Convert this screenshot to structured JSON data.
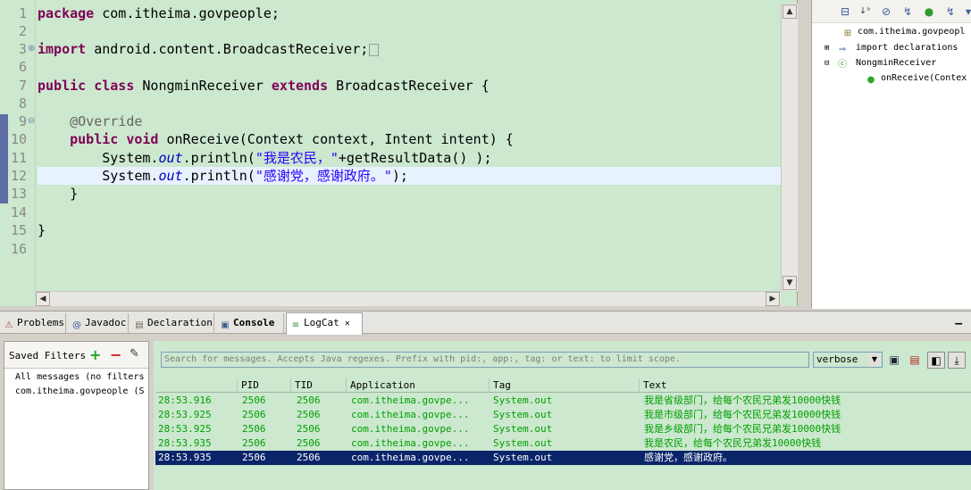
{
  "editor": {
    "line_numbers": [
      "1",
      "2",
      "3",
      "6",
      "7",
      "8",
      "9",
      "10",
      "11",
      "12",
      "13",
      "14",
      "15",
      "16"
    ],
    "lines": {
      "l1_kw": "package",
      "l1_rest": " com.itheima.govpeople;",
      "l3_kw": "import",
      "l3_rest": " android.content.BroadcastReceiver;",
      "l7_kw1": "public",
      "l7_kw2": "class",
      "l7_name": " NongminReceiver ",
      "l7_kw3": "extends",
      "l7_rest": " BroadcastReceiver {",
      "l9_ann": "@Override",
      "l10_kw1": "public",
      "l10_kw2": "void",
      "l10_rest": " onReceive(Context context, Intent intent) {",
      "l11_a": "System.",
      "l11_fld": "out",
      "l11_b": ".println(",
      "l11_str": "\"我是农民，\"",
      "l11_c": "+getResultData() );",
      "l12_a": "System.",
      "l12_fld": "out",
      "l12_b": ".println(",
      "l12_str": "\"感谢党，感谢政府。\"",
      "l12_c": ");",
      "l13": "    }",
      "l15": "}"
    }
  },
  "outline": {
    "items": [
      {
        "label": "com.itheima.govpeopl",
        "icon": "package-icon"
      },
      {
        "label": "import declarations",
        "icon": "import-icon"
      },
      {
        "label": "NongminReceiver",
        "icon": "class-icon"
      },
      {
        "label": "onReceive(Contex",
        "icon": "method-icon"
      }
    ]
  },
  "tabs": [
    {
      "label": "Problems",
      "icon": "problems-icon"
    },
    {
      "label": "Javadoc",
      "icon": "javadoc-icon"
    },
    {
      "label": "Declaration",
      "icon": "declaration-icon"
    },
    {
      "label": "Console",
      "icon": "console-icon"
    },
    {
      "label": "LogCat",
      "icon": "logcat-icon"
    }
  ],
  "filters": {
    "title": "Saved Filters",
    "items": [
      "All messages (no filters",
      "com.itheima.govpeople (S"
    ]
  },
  "logcat": {
    "search_placeholder": "Search for messages. Accepts Java regexes. Prefix with pid:, app:, tag: or text: to limit scope.",
    "level": "verbose",
    "columns": [
      "",
      "PID",
      "TID",
      "Application",
      "Tag",
      "Text"
    ],
    "rows": [
      {
        "time": "28:53.916",
        "pid": "2506",
        "tid": "2506",
        "app": "com.itheima.govpe...",
        "tag": "System.out",
        "text": "我是省级部门，给每个农民兄弟发10000快钱"
      },
      {
        "time": "28:53.925",
        "pid": "2506",
        "tid": "2506",
        "app": "com.itheima.govpe...",
        "tag": "System.out",
        "text": "我是市级部门，给每个农民兄弟发10000快钱"
      },
      {
        "time": "28:53.925",
        "pid": "2506",
        "tid": "2506",
        "app": "com.itheima.govpe...",
        "tag": "System.out",
        "text": "我是乡级部门，给每个农民兄弟发10000快钱"
      },
      {
        "time": "28:53.935",
        "pid": "2506",
        "tid": "2506",
        "app": "com.itheima.govpe...",
        "tag": "System.out",
        "text": "我是农民，给每个农民兄弟发10000快钱"
      },
      {
        "time": "28:53.935",
        "pid": "2506",
        "tid": "2506",
        "app": "com.itheima.govpe...",
        "tag": "System.out",
        "text": "感谢党，感谢政府。"
      }
    ]
  },
  "colors": {
    "editor_bg": "#cce8cf",
    "keyword": "#7f0055",
    "string": "#2a00ff",
    "log_text": "#00a000",
    "selection": "#0a246a"
  }
}
